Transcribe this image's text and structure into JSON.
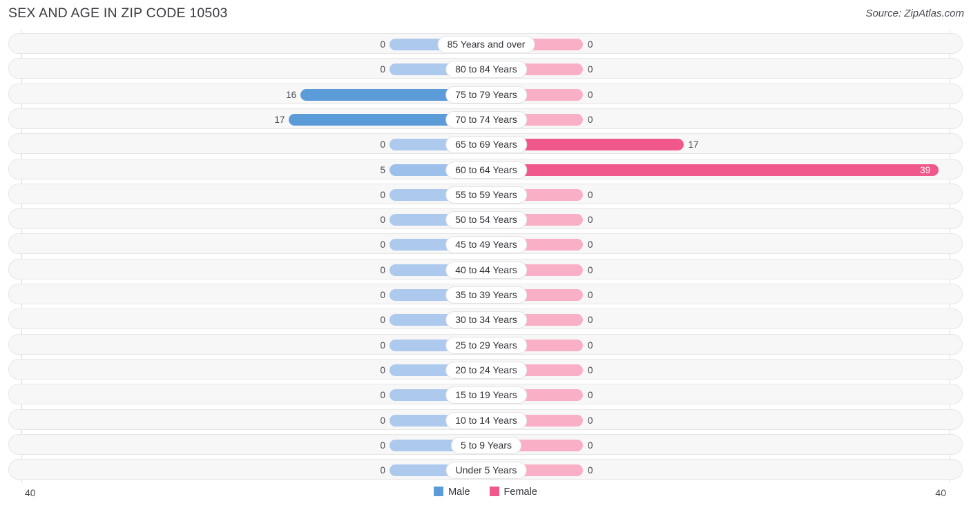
{
  "header": {
    "title": "SEX AND AGE IN ZIP CODE 10503",
    "source": "Source: ZipAtlas.com"
  },
  "legend": {
    "items": [
      {
        "label": "Male",
        "color": "#5b9bd8"
      },
      {
        "label": "Female",
        "color": "#f0588b"
      }
    ]
  },
  "axis": {
    "left_tick": "40",
    "right_tick": "40",
    "max": 40
  },
  "chart_data": {
    "type": "bar",
    "subtype": "population-pyramid",
    "title": "SEX AND AGE IN ZIP CODE 10503",
    "xlabel": "",
    "ylabel": "",
    "xlim": [
      -40,
      40
    ],
    "grid": false,
    "legend_position": "bottom-center",
    "categories": [
      "85 Years and over",
      "80 to 84 Years",
      "75 to 79 Years",
      "70 to 74 Years",
      "65 to 69 Years",
      "60 to 64 Years",
      "55 to 59 Years",
      "50 to 54 Years",
      "45 to 49 Years",
      "40 to 44 Years",
      "35 to 39 Years",
      "30 to 34 Years",
      "25 to 29 Years",
      "20 to 24 Years",
      "15 to 19 Years",
      "10 to 14 Years",
      "5 to 9 Years",
      "Under 5 Years"
    ],
    "series": [
      {
        "name": "Male",
        "values": [
          0,
          0,
          16,
          17,
          0,
          5,
          0,
          0,
          0,
          0,
          0,
          0,
          0,
          0,
          0,
          0,
          0,
          0
        ]
      },
      {
        "name": "Female",
        "values": [
          0,
          0,
          0,
          0,
          17,
          39,
          0,
          0,
          0,
          0,
          0,
          0,
          0,
          0,
          0,
          0,
          0,
          0
        ]
      }
    ],
    "value_labels": {
      "Male": [
        "0",
        "0",
        "16",
        "17",
        "0",
        "5",
        "0",
        "0",
        "0",
        "0",
        "0",
        "0",
        "0",
        "0",
        "0",
        "0",
        "0",
        "0"
      ],
      "Female": [
        "0",
        "0",
        "0",
        "0",
        "17",
        "39",
        "0",
        "0",
        "0",
        "0",
        "0",
        "0",
        "0",
        "0",
        "0",
        "0",
        "0",
        "0"
      ]
    }
  }
}
